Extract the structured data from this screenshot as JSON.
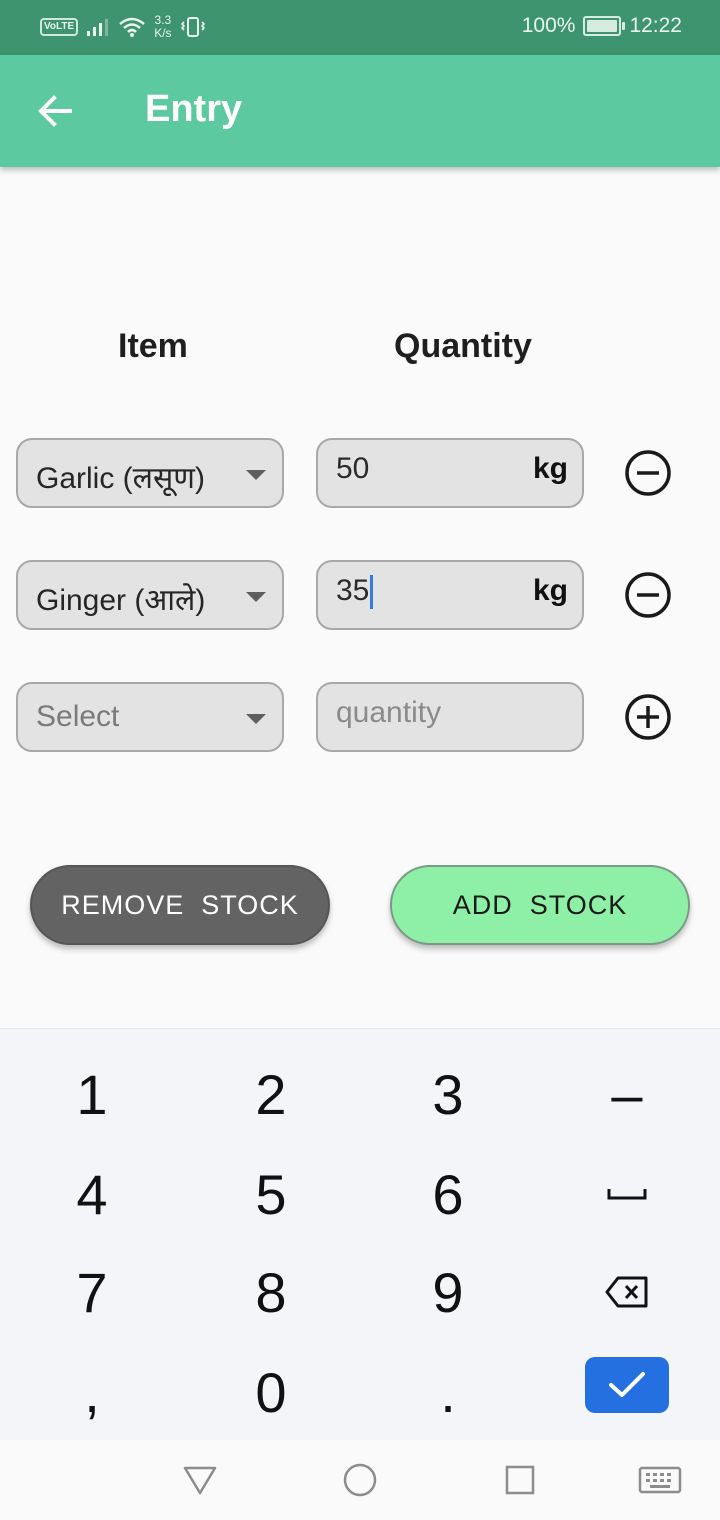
{
  "status_bar": {
    "network_badge": "VoLTE",
    "speed_value": "3.3",
    "speed_unit": "K/s",
    "battery": "100%",
    "time": "12:22"
  },
  "app_bar": {
    "title": "Entry"
  },
  "headers": {
    "item": "Item",
    "quantity": "Quantity"
  },
  "rows": [
    {
      "item": "Garlic (लसूण)",
      "quantity": "50",
      "unit": "kg",
      "action_icon": "minus-circle-icon"
    },
    {
      "item": "Ginger (आले)",
      "quantity": "35",
      "unit": "kg",
      "action_icon": "minus-circle-icon"
    },
    {
      "item_placeholder": "Select",
      "quantity_placeholder": "quantity",
      "action_icon": "plus-circle-icon"
    }
  ],
  "buttons": {
    "remove": "REMOVE  STOCK",
    "add": "ADD  STOCK"
  },
  "keyboard": {
    "keys": [
      "1",
      "2",
      "3",
      "–",
      "4",
      "5",
      "6",
      "␣",
      "7",
      "8",
      "9",
      "⌫",
      ",",
      "0",
      "."
    ],
    "enter_icon": "check-icon"
  },
  "colors": {
    "status_bar": "#3f9470",
    "app_bar": "#5cc9a0",
    "remove_button": "#636363",
    "add_button": "#8ef0a6",
    "enter_key": "#2470e0"
  }
}
